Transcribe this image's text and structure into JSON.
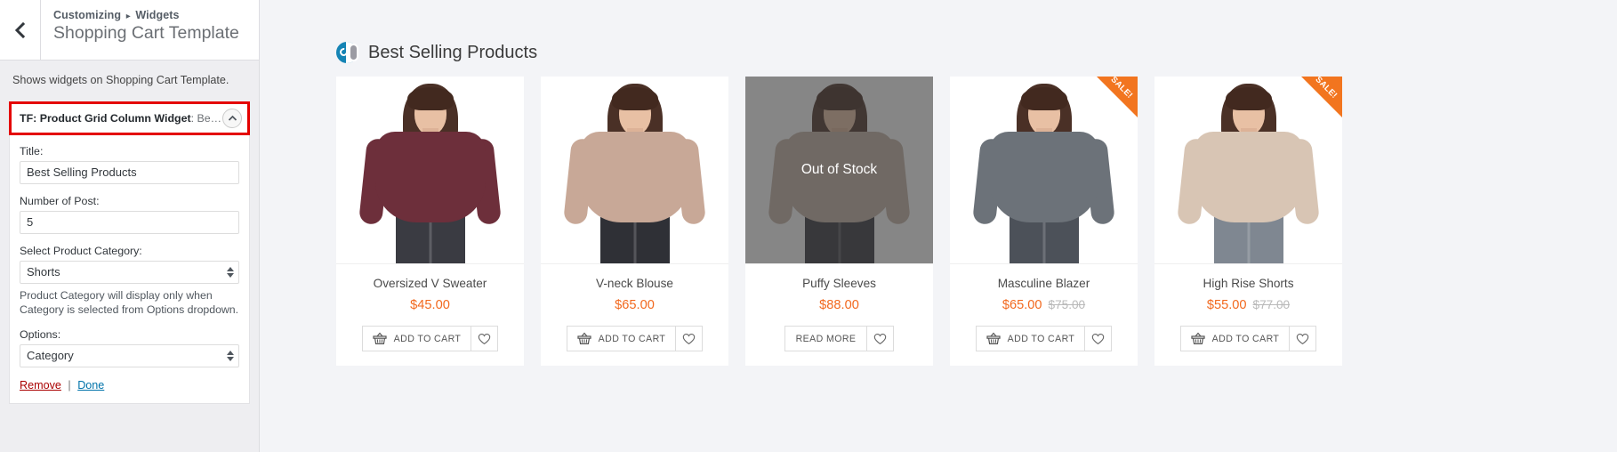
{
  "sidebar": {
    "back_icon": "chevron-left-icon",
    "breadcrumb_root": "Customizing",
    "breadcrumb_sep": "▸",
    "breadcrumb_current": "Widgets",
    "panel_title": "Shopping Cart Template",
    "description": "Shows widgets on Shopping Cart Template.",
    "widget": {
      "head_title": "TF: Product Grid Column Widget",
      "head_title_suffix": ": Be…",
      "toggle_icon": "chevron-up-icon",
      "fields": {
        "title_label": "Title:",
        "title_value": "Best Selling Products",
        "title_placeholder": "Title",
        "count_label": "Number of Post:",
        "count_value": "5",
        "category_label": "Select Product Category:",
        "category_value": "Shorts",
        "category_help": "Product Category will display only when Category is selected from Options dropdown.",
        "options_label": "Options:",
        "options_value": "Category"
      },
      "actions": {
        "remove": "Remove",
        "separator": "|",
        "done": "Done"
      }
    }
  },
  "preview": {
    "brand_icon": "brand-logo-icon",
    "section_title": "Best Selling Products",
    "labels": {
      "add_to_cart": "ADD TO CART",
      "read_more": "READ MORE",
      "out_of_stock": "Out of Stock",
      "sale_badge": "SALE!",
      "cart_icon": "shopping-basket-icon",
      "wishlist_icon": "heart-icon"
    },
    "products": [
      {
        "name": "Oversized V Sweater",
        "price": "$45.00",
        "old_price": "",
        "button": "ADD TO CART",
        "on_sale": false,
        "out_of_stock": false,
        "top_color": "#6d2f3b",
        "pants_color": "#3a3b42"
      },
      {
        "name": "V-neck Blouse",
        "price": "$65.00",
        "old_price": "",
        "button": "ADD TO CART",
        "on_sale": false,
        "out_of_stock": false,
        "top_color": "#c8a897",
        "pants_color": "#2f3036"
      },
      {
        "name": "Puffy Sleeves",
        "price": "$88.00",
        "old_price": "",
        "button": "READ MORE",
        "on_sale": false,
        "out_of_stock": true,
        "top_color": "#c4b3a6",
        "pants_color": "#33343a"
      },
      {
        "name": "Masculine Blazer",
        "price": "$65.00",
        "old_price": "$75.00",
        "button": "ADD TO CART",
        "on_sale": true,
        "out_of_stock": false,
        "top_color": "#6c7279",
        "pants_color": "#4c5159"
      },
      {
        "name": "High Rise Shorts",
        "price": "$55.00",
        "old_price": "$77.00",
        "button": "ADD TO CART",
        "on_sale": true,
        "out_of_stock": false,
        "top_color": "#d8c5b4",
        "pants_color": "#7f8791"
      }
    ]
  },
  "colors": {
    "accent_price": "#f2691f",
    "sale_badge": "#f2751f",
    "highlight_outline": "#e40000",
    "link": "#0073aa",
    "remove_link": "#a00000",
    "brand_blue": "#1584b5"
  }
}
